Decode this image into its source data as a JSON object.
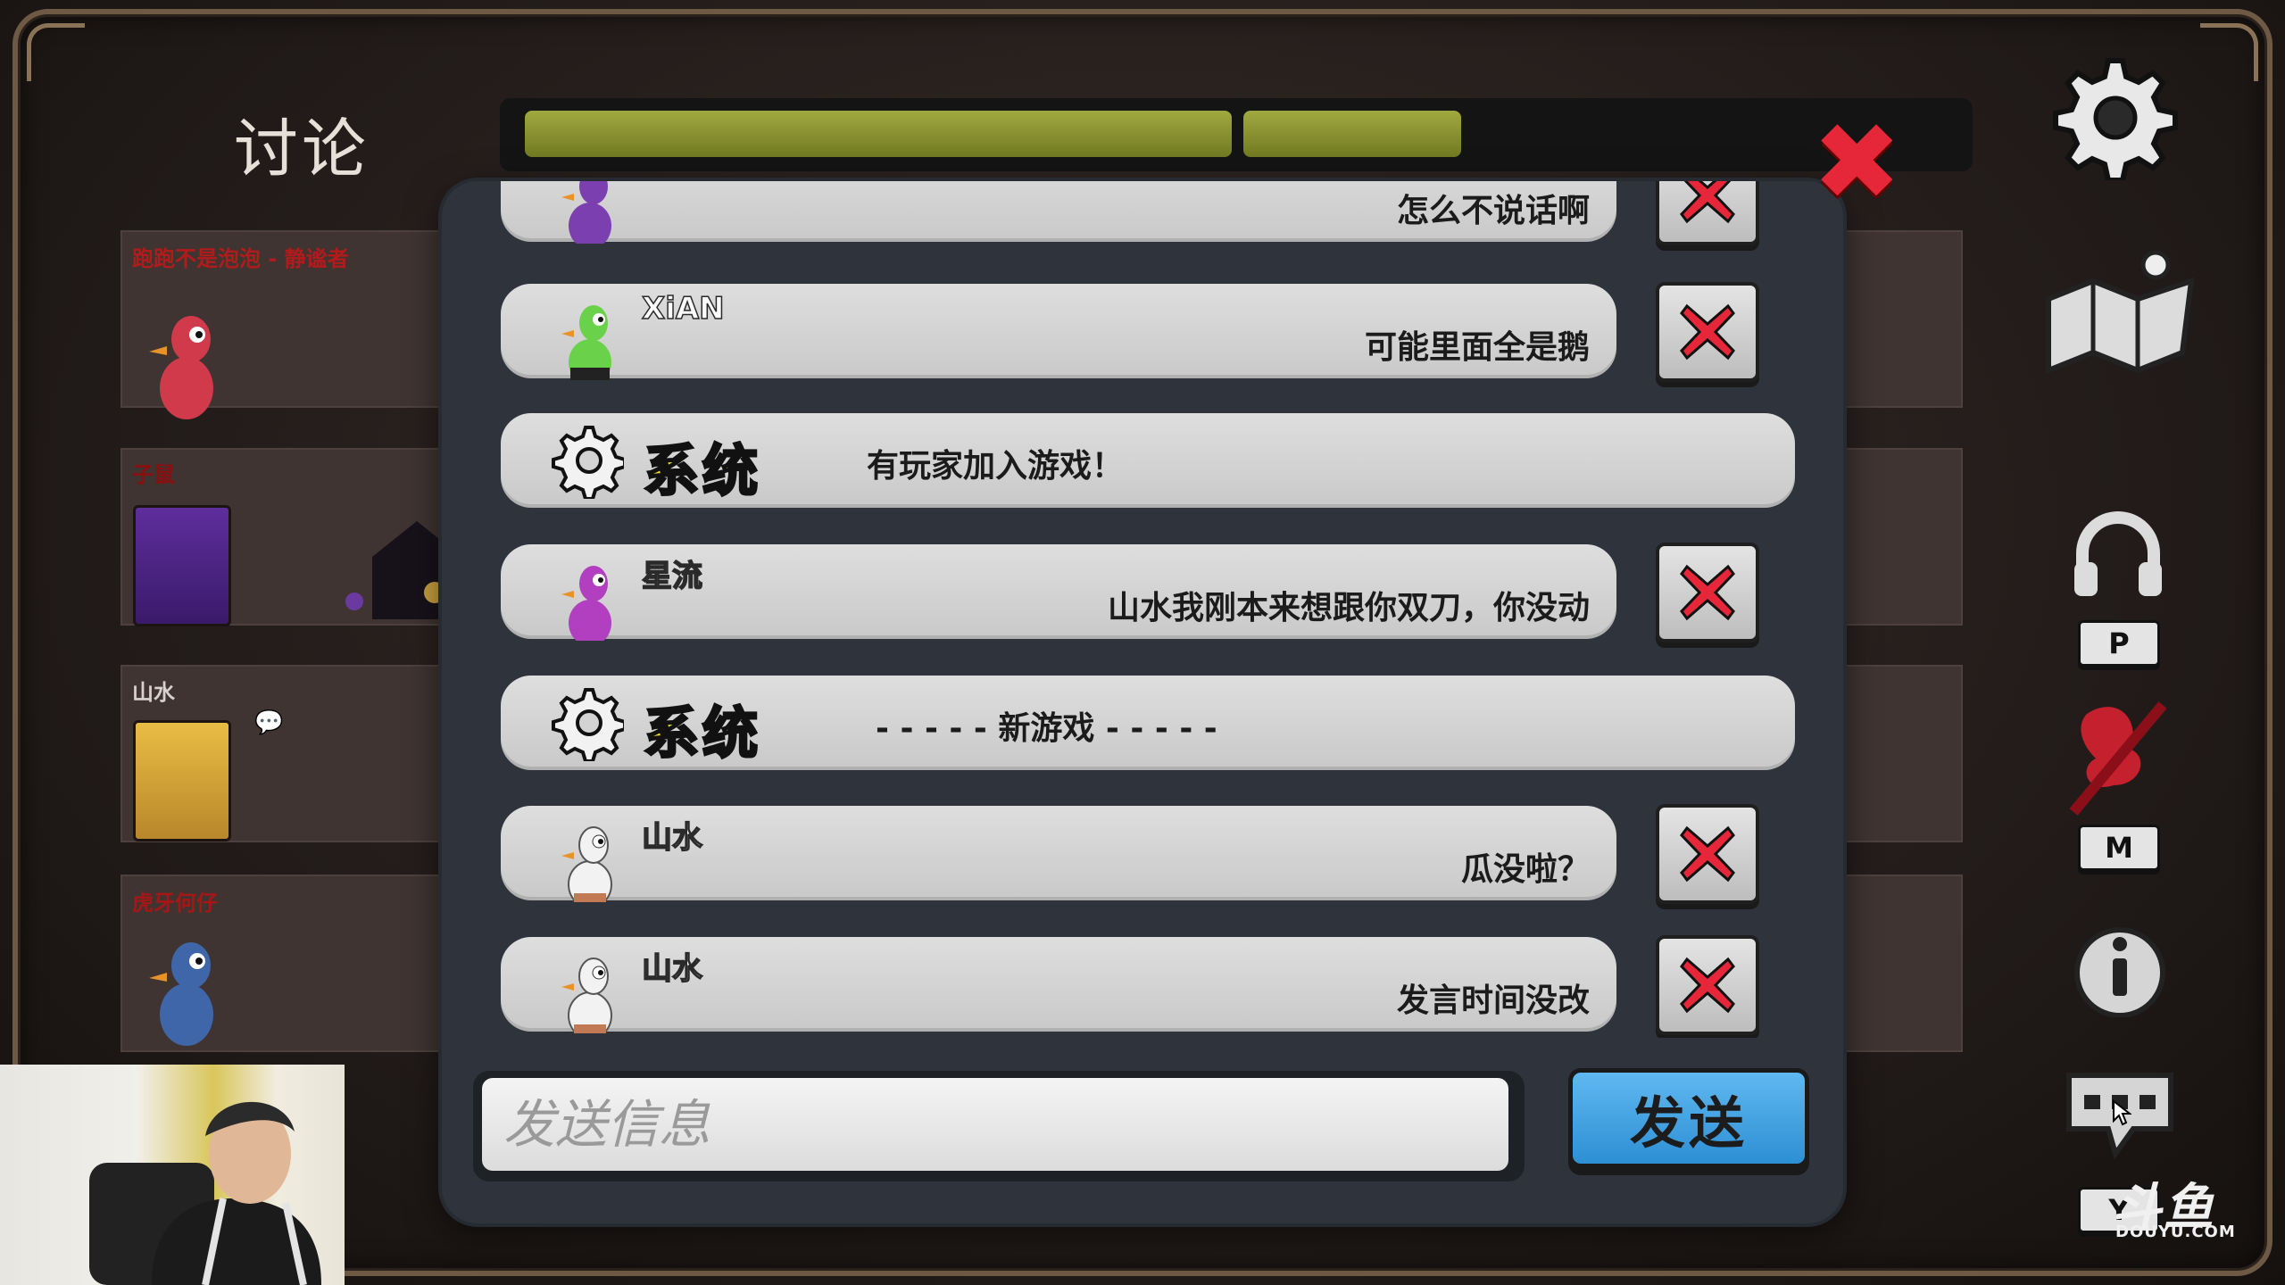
{
  "header": {
    "title": "讨论",
    "timer_remaining_fraction": 0.46
  },
  "players": [
    {
      "name": "跑跑不是泡泡 - 静谧者",
      "name_color": "#b21b1b"
    },
    {
      "name": "子鼠",
      "name_color": "#8a1010"
    },
    {
      "name": "山水",
      "name_color": "#d8d2cc"
    },
    {
      "name": "虎牙何仔",
      "name_color": "#a51717"
    }
  ],
  "chat": {
    "messages": [
      {
        "kind": "player",
        "name": "",
        "text": "怎么不说话啊",
        "color": "#7b3fb0"
      },
      {
        "kind": "player",
        "name": "XiAN",
        "text": "可能里面全是鹅",
        "color": "#6ad14a"
      },
      {
        "kind": "system",
        "label": "系统",
        "text": "有玩家加入游戏！"
      },
      {
        "kind": "player",
        "name": "星流",
        "text": "山水我刚本来想跟你双刀，你没动",
        "color": "#b23ec0"
      },
      {
        "kind": "system",
        "label": "系统",
        "text": "- - - - - 新游戏 - - - - -"
      },
      {
        "kind": "player",
        "name": "山水",
        "text": "瓜没啦？",
        "color": "#f2f2f2"
      },
      {
        "kind": "player",
        "name": "山水",
        "text": "发言时间没改",
        "color": "#f2f2f2"
      }
    ],
    "input": {
      "placeholder": "发送信息",
      "value": ""
    },
    "send_label": "发送"
  },
  "rail": {
    "push_to_talk_key": "P",
    "mute_key": "M",
    "chat_key": "Y"
  },
  "watermark": {
    "brand": "斗鱼",
    "domain": "DOUYU.COM"
  },
  "colors": {
    "accent_blue": "#3a9ee4",
    "delete_red": "#e6273a",
    "system_yellow": "#f2e21a",
    "timer_green": "#8a9430"
  }
}
